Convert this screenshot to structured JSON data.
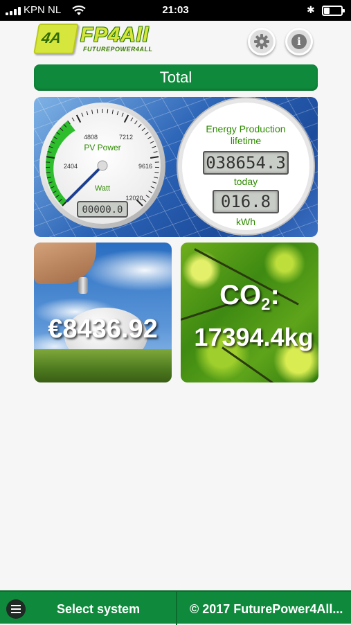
{
  "status_bar": {
    "carrier": "KPN NL",
    "time": "21:03",
    "icons": [
      "signal-icon",
      "wifi-icon",
      "bluetooth-icon",
      "battery-icon"
    ]
  },
  "header": {
    "logo_word": "FP4All",
    "logo_tagline": "FUTUREPOWER4ALL",
    "logo_badge": "4A",
    "settings_icon": "gear-icon",
    "info_icon": "info-icon",
    "info_glyph": "i"
  },
  "title_bar": {
    "label": "Total"
  },
  "gauge": {
    "title": "PV Power",
    "unit": "Watt",
    "ticks": [
      "2404",
      "4808",
      "7212",
      "9616",
      "12020"
    ],
    "value": 0,
    "max": 12020,
    "display": "00000.0"
  },
  "energy": {
    "lifetime_label_1": "Energy Production",
    "lifetime_label_2": "lifetime",
    "lifetime_value": "038654.3",
    "today_label": "today",
    "today_value": "016.8",
    "unit": "kWh"
  },
  "savings": {
    "amount": "€8436.92"
  },
  "co2": {
    "label_prefix": "CO",
    "label_sub": "2",
    "label_suffix": ":",
    "value": "17394.4kg"
  },
  "bottom_bar": {
    "menu_icon": "hamburger-icon",
    "select_label": "Select system",
    "copyright": "© 2017 FuturePower4All..."
  },
  "colors": {
    "accent_green": "#0f8a3c",
    "gauge_green": "#2dbd2d",
    "needle_blue": "#1d3f8f"
  }
}
